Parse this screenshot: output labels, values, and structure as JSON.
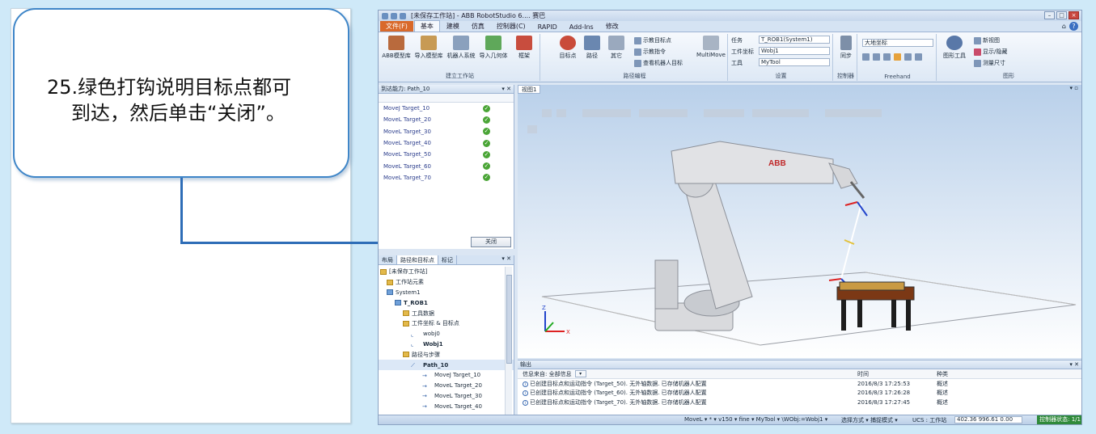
{
  "callout": {
    "line1": "25.绿色打钩说明目标点都可",
    "line2": "到达，然后单击“关闭”。"
  },
  "app": {
    "title": "[未保存工作站] - ABB RobotStudio 6....  赛巴",
    "tabs": [
      "文件(F)",
      "基本",
      "建模",
      "仿真",
      "控制器(C)",
      "RAPID",
      "Add-Ins",
      "修改"
    ],
    "active_tab": "基本",
    "ribbon": {
      "build_station": {
        "label": "建立工作站",
        "buttons": [
          "ABB模型库",
          "导入模型库",
          "机器人系统",
          "导入几何体",
          "框架"
        ]
      },
      "path_programming": {
        "label": "路径编程",
        "buttons": [
          "目标点",
          "路径",
          "其它"
        ],
        "small": [
          "示教目标点",
          "示教指令",
          "查看机器人目标"
        ],
        "multimove": "MultiMove"
      },
      "settings": {
        "label": "设置",
        "task_label": "任务",
        "task_value": "T_ROB1(System1)",
        "wobj_label": "工件坐标",
        "wobj_value": "Wobj1",
        "tool_label": "工具",
        "tool_value": "MyTool"
      },
      "controller": {
        "label": "控制器",
        "sync": "同步"
      },
      "freehand": {
        "label": "Freehand",
        "frame": "大地坐标"
      },
      "graphics": {
        "label": "图形",
        "graphics_tools": "图形工具",
        "new_view": "新视图",
        "show_hide": "显示/隐藏",
        "measure": "测量尺寸"
      }
    },
    "reach_panel": {
      "title": "到达能力: Path_10",
      "rows": [
        {
          "label": "MoveJ Target_10",
          "status": "✓"
        },
        {
          "label": "MoveL Target_20",
          "status": "✓"
        },
        {
          "label": "MoveL Target_30",
          "status": "✓"
        },
        {
          "label": "MoveL Target_40",
          "status": "✓"
        },
        {
          "label": "MoveL Target_50",
          "status": "✓"
        },
        {
          "label": "MoveL Target_60",
          "status": "✓"
        },
        {
          "label": "MoveL Target_70",
          "status": "✓"
        }
      ],
      "close_label": "关闭"
    },
    "tree_panel": {
      "tabs": [
        "布局",
        "路径和目标点",
        "标记"
      ],
      "rows": [
        {
          "text": "[未保存工作站]",
          "indent": 0
        },
        {
          "text": "工作站元素",
          "indent": 1
        },
        {
          "text": "System1",
          "indent": 1
        },
        {
          "text": "T_ROB1",
          "indent": 2,
          "bold": true
        },
        {
          "text": "工具数据",
          "indent": 3
        },
        {
          "text": "工件坐标 & 目标点",
          "indent": 3
        },
        {
          "text": "wobj0",
          "indent": 4
        },
        {
          "text": "Wobj1",
          "indent": 4,
          "bold": true
        },
        {
          "text": "路径与步骤",
          "indent": 3
        },
        {
          "text": "Path_10",
          "indent": 4,
          "bold": true
        },
        {
          "text": "MoveJ Target_10",
          "indent": 5
        },
        {
          "text": "MoveL Target_20",
          "indent": 5
        },
        {
          "text": "MoveL Target_30",
          "indent": 5
        },
        {
          "text": "MoveL Target_40",
          "indent": 5
        }
      ]
    },
    "view": {
      "tab": "视图1",
      "brand": "ABB"
    },
    "output": {
      "title": "输出",
      "filter_label": "信息来自: 全部信息",
      "col_time": "时间",
      "col_category": "种类",
      "rows": [
        {
          "msg": "已创建目标点和运动指令 (Target_50). 无外轴数据. 已存储机器人配置",
          "time": "2016/8/3 17:25:53",
          "cat": "概述"
        },
        {
          "msg": "已创建目标点和运动指令 (Target_60). 无外轴数据. 已存储机器人配置",
          "time": "2016/8/3 17:26:28",
          "cat": "概述"
        },
        {
          "msg": "已创建目标点和运动指令 (Target_70). 无外轴数据. 已存储机器人配置",
          "time": "2016/8/3 17:27:45",
          "cat": "概述"
        }
      ]
    },
    "status": {
      "instruction": "MoveL ▾ * ▾ v150 ▾ fine ▾ MyTool ▾ \\WObj:=Wobj1 ▾",
      "select_mode": "选择方式 ▾ 捕捉模式 ▾",
      "ucs": "UCS : 工作站",
      "coords": "402.36  996.61  0.00",
      "controller_status": "控制器状态: 1/1"
    }
  }
}
